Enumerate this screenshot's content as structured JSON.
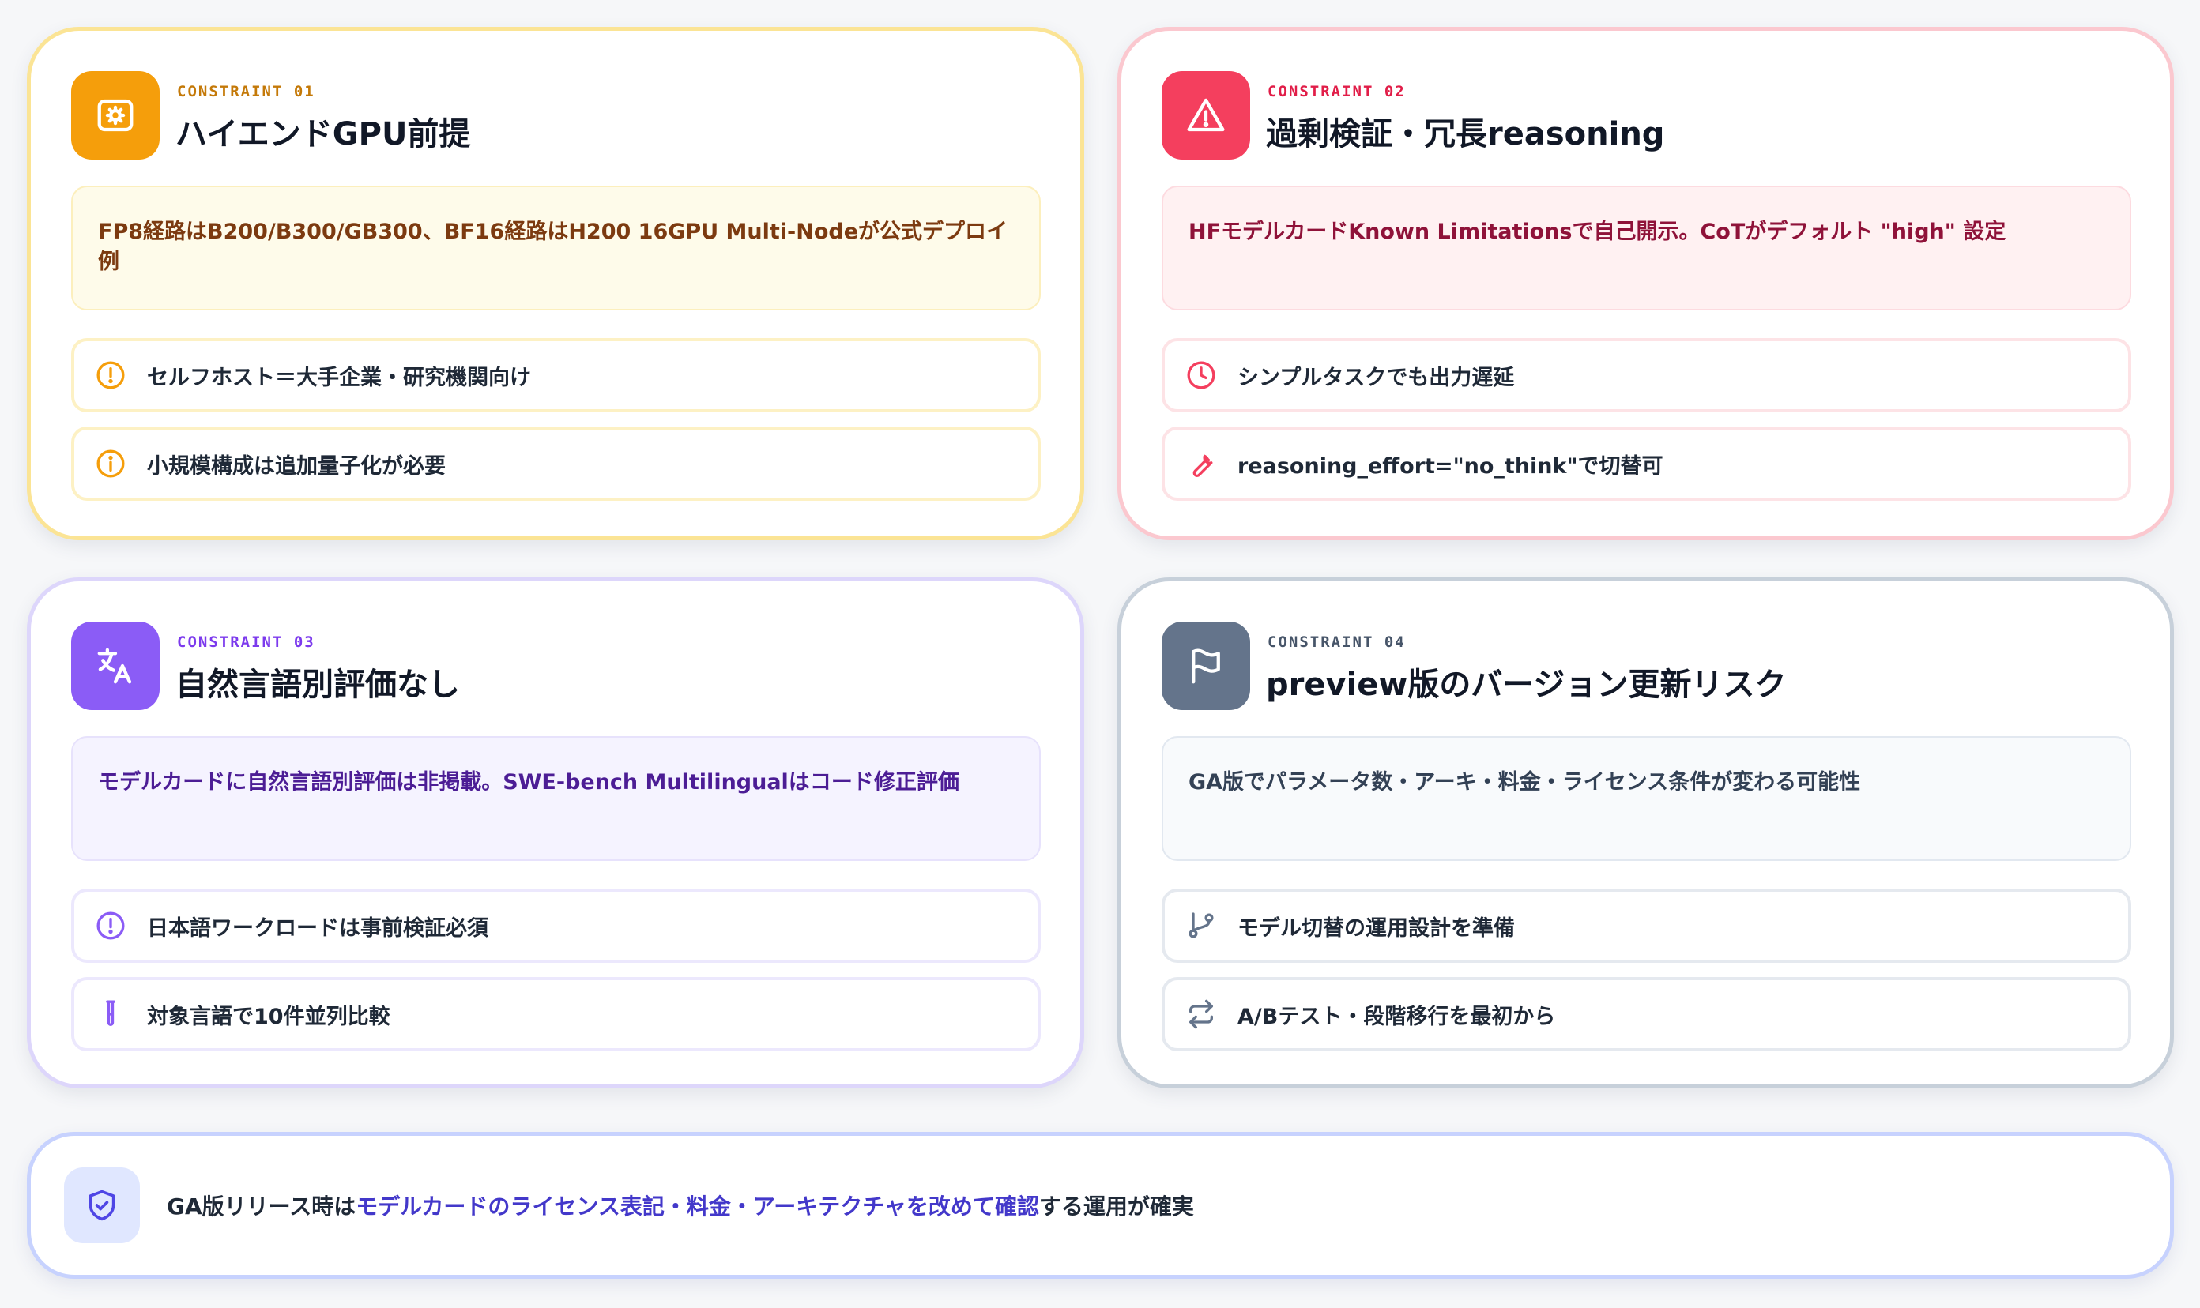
{
  "cards": [
    {
      "tag": "CONSTRAINT 01",
      "title": "ハイエンドGPU前提",
      "description": "FP8経路はB200/B300/GB300、BF16経路はH200 16GPU Multi-Nodeが公式デプロイ例",
      "items": [
        {
          "text": "セルフホスト＝大手企業・研究機関向け",
          "icon": "alert-circle-icon"
        },
        {
          "text": "小規模構成は追加量子化が必要",
          "icon": "info-icon"
        }
      ],
      "icon": "gpu-chip-icon",
      "accent": "#f59e0b"
    },
    {
      "tag": "CONSTRAINT 02",
      "title": "過剰検証・冗長reasoning",
      "description": "HFモデルカードKnown Limitationsで自己開示。CoTがデフォルト \"high\" 設定",
      "items": [
        {
          "text": "シンプルタスクでも出力遅延",
          "icon": "clock-icon"
        },
        {
          "text": "reasoning_effort=\"no_think\"で切替可",
          "icon": "wrench-icon"
        }
      ],
      "icon": "warning-triangle-icon",
      "accent": "#f43f5e"
    },
    {
      "tag": "CONSTRAINT 03",
      "title": "自然言語別評価なし",
      "description": "モデルカードに自然言語別評価は非掲載。SWE-bench Multilingualはコード修正評価",
      "items": [
        {
          "text": "日本語ワークロードは事前検証必須",
          "icon": "alert-circle-icon"
        },
        {
          "text": "対象言語で10件並列比較",
          "icon": "test-tube-icon"
        }
      ],
      "icon": "translate-icon",
      "accent": "#8b5cf6"
    },
    {
      "tag": "CONSTRAINT 04",
      "title": "preview版のバージョン更新リスク",
      "description": "GA版でパラメータ数・アーキ・料金・ライセンス条件が変わる可能性",
      "items": [
        {
          "text": "モデル切替の運用設計を準備",
          "icon": "git-branch-icon"
        },
        {
          "text": "A/Bテスト・段階移行を最初から",
          "icon": "repeat-arrows-icon"
        }
      ],
      "icon": "flag-icon",
      "accent": "#64748b"
    }
  ],
  "banner": {
    "prefix": "GA版リリース時は",
    "highlight": "モデルカードのライセンス表記・料金・アーキテクチャを改めて確認",
    "suffix": "する運用が確実",
    "icon": "shield-check-icon",
    "accent": "#4338ca"
  }
}
